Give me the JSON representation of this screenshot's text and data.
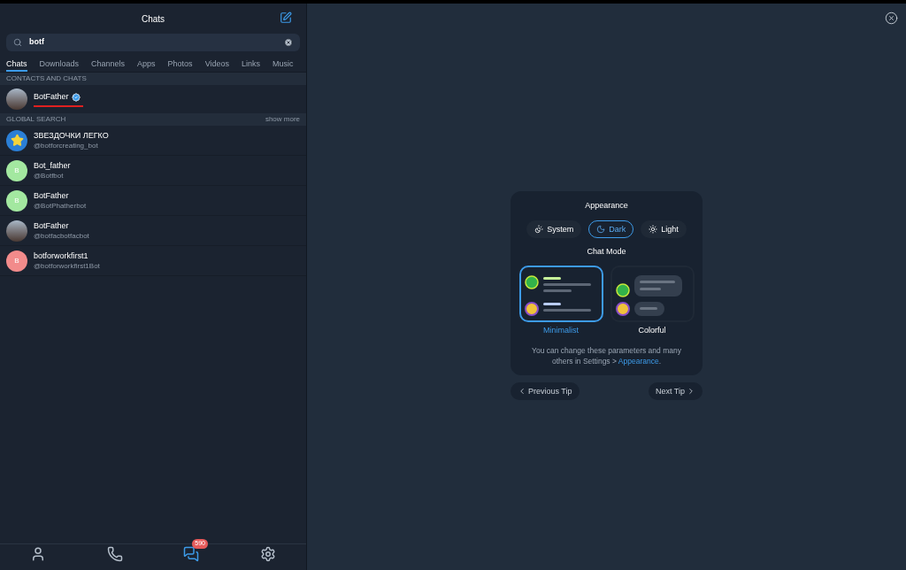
{
  "header": {
    "title": "Chats"
  },
  "search": {
    "value": "botf"
  },
  "tabs": [
    {
      "label": "Chats",
      "selected": true
    },
    {
      "label": "Downloads",
      "selected": false
    },
    {
      "label": "Channels",
      "selected": false
    },
    {
      "label": "Apps",
      "selected": false
    },
    {
      "label": "Photos",
      "selected": false
    },
    {
      "label": "Videos",
      "selected": false
    },
    {
      "label": "Links",
      "selected": false
    },
    {
      "label": "Music",
      "selected": false
    }
  ],
  "contacts_section": {
    "title": "CONTACTS AND CHATS",
    "items": [
      {
        "name": "BotFather",
        "verified": true,
        "kind": "photo",
        "marked": true
      }
    ]
  },
  "global_section": {
    "title": "GLOBAL SEARCH",
    "action": "show more",
    "items": [
      {
        "name": "ЗВЕЗДОЧКИ ЛЕГКО",
        "username": "@botforcreating_bot",
        "kind": "star"
      },
      {
        "name": "Bot_father",
        "username": "@Botfbot",
        "kind": "letter",
        "letter": "B",
        "color": "#a3e8a0"
      },
      {
        "name": "BotFather",
        "username": "@BotPhatherbot",
        "kind": "letter",
        "letter": "B",
        "color": "#a3e8a0"
      },
      {
        "name": "BotFather",
        "username": "@botfacbotfacbot",
        "kind": "photo"
      },
      {
        "name": "botforworkfirst1",
        "username": "@botforworkfirst1Bot",
        "kind": "letter",
        "letter": "B",
        "color": "#f28b8b"
      }
    ]
  },
  "bottom_nav": [
    {
      "kind": "contacts",
      "selected": false
    },
    {
      "kind": "calls",
      "selected": false
    },
    {
      "kind": "chats",
      "selected": true,
      "badge": "590"
    },
    {
      "kind": "settings",
      "selected": false
    }
  ],
  "tip": {
    "title": "Appearance",
    "themes": [
      {
        "kind": "system",
        "label": "System",
        "selected": false
      },
      {
        "kind": "dark",
        "label": "Dark",
        "selected": true
      },
      {
        "kind": "light",
        "label": "Light",
        "selected": false
      }
    ],
    "mode_title": "Chat Mode",
    "modes": [
      {
        "kind": "minimalist",
        "label": "Minimalist",
        "selected": true
      },
      {
        "kind": "colorful",
        "label": "Colorful",
        "selected": false
      }
    ],
    "text": "You can change these parameters and many others in Settings > ",
    "link": "Appearance",
    "text_end": ".",
    "previous": "Previous Tip",
    "next": "Next Tip"
  }
}
